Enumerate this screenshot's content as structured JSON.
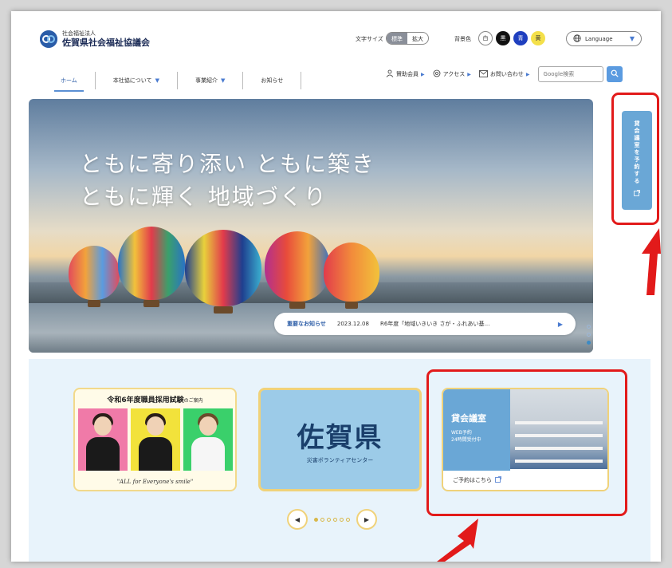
{
  "header": {
    "org_type": "社会福祉法人",
    "org_name": "佐賀県社会福祉協議会",
    "logo_icon": "hands-logo-icon"
  },
  "toolbar": {
    "font_size_label": "文字サイズ",
    "font_size_options": [
      "標準",
      "拡大"
    ],
    "font_size_selected": "標準",
    "bg_color_label": "背景色",
    "bg_color_options": [
      {
        "label": "白",
        "color": "#ffffff",
        "text": "#333333"
      },
      {
        "label": "黒",
        "color": "#111111",
        "text": "#ffffff"
      },
      {
        "label": "青",
        "color": "#1f3fbf",
        "text": "#ffffff"
      },
      {
        "label": "黄",
        "color": "#f4e04a",
        "text": "#333333"
      }
    ],
    "language_label": "Language"
  },
  "nav": {
    "items": [
      {
        "label": "ホーム",
        "active": true,
        "has_menu": false
      },
      {
        "label": "本社協について",
        "active": false,
        "has_menu": true
      },
      {
        "label": "事業紹介",
        "active": false,
        "has_menu": true
      },
      {
        "label": "お知らせ",
        "active": false,
        "has_menu": false
      }
    ]
  },
  "utility": {
    "links": [
      "賛助会員",
      "アクセス",
      "お問い合わせ"
    ],
    "search_placeholder": "Google検索"
  },
  "hero": {
    "headline_line1": "ともに寄り添い ともに築き",
    "headline_line2": "ともに輝く 地域づくり",
    "news_label": "重要なお知らせ",
    "news_date": "2023.12.08",
    "news_text": "R6年度「地域いきいき さが・ふれあい基…",
    "slide_count": 3,
    "slide_active": 3
  },
  "side_tab": {
    "label": "貸会議室を予約する"
  },
  "banners": {
    "recruit_title": "令和6年度職員採用試験",
    "recruit_suffix": "のご案内",
    "recruit_tagline": "\"ALL for Everyone's smile\"",
    "volunteer_big": "佐賀県",
    "volunteer_small": "災害ボランティアセンター",
    "room_title": "貸会議室",
    "room_sub1": "WEB予約",
    "room_sub2": "24時間受付中",
    "room_cta": "ご予約はこちら"
  },
  "pager": {
    "dot_count": 6,
    "active": 1
  },
  "colors": {
    "accent_blue": "#6aa7d6",
    "brand_navy": "#1a2a55",
    "annotation_red": "#e21a1a",
    "card_border_gold": "#f0d27a"
  }
}
